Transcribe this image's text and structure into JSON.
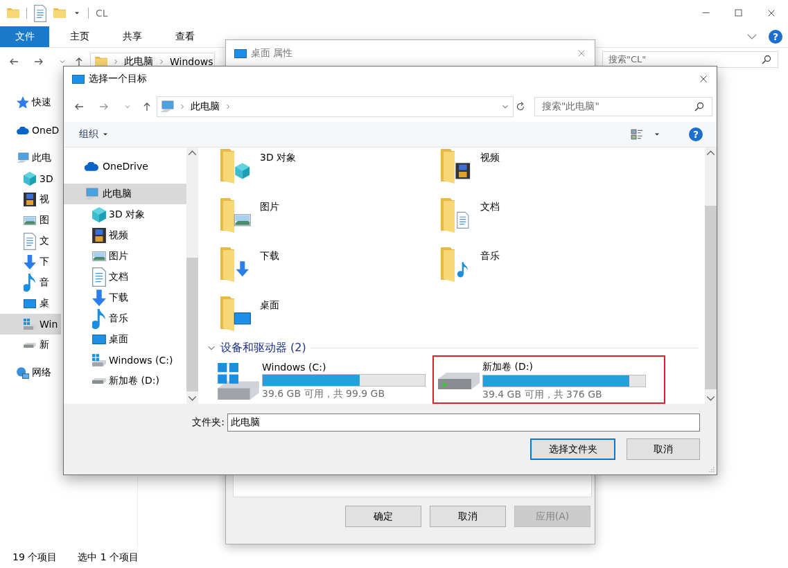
{
  "explorer": {
    "title": "CL",
    "ribbon_tabs": [
      {
        "label": "文件",
        "selected": true
      },
      {
        "label": "主页",
        "selected": false
      },
      {
        "label": "共享",
        "selected": false
      },
      {
        "label": "查看",
        "selected": false
      }
    ],
    "help": "?",
    "address": [
      "此电脑",
      "Windows"
    ],
    "search": {
      "placeholder": "搜索\"CL\""
    },
    "nav": [
      {
        "label": "快速",
        "kind": "star",
        "selected": false
      },
      {
        "label": "OneD",
        "kind": "cloud",
        "selected": false
      },
      {
        "label": "此电",
        "kind": "pc",
        "selected": false,
        "children": [
          {
            "label": "3D",
            "kind": "cube",
            "selected": false
          },
          {
            "label": "视",
            "kind": "video",
            "selected": false
          },
          {
            "label": "图",
            "kind": "pictures",
            "selected": false
          },
          {
            "label": "文",
            "kind": "docs",
            "selected": false
          },
          {
            "label": "下",
            "kind": "downloads",
            "selected": false
          },
          {
            "label": "音",
            "kind": "music",
            "selected": false
          },
          {
            "label": "桌",
            "kind": "desktop",
            "selected": false
          },
          {
            "label": "Win",
            "kind": "windrive",
            "selected": true
          },
          {
            "label": "新",
            "kind": "drive",
            "selected": false
          }
        ]
      },
      {
        "label": "网络",
        "kind": "network",
        "selected": false
      }
    ],
    "status_bar": {
      "count": "19 个项目",
      "selection": "选中 1 个项目"
    }
  },
  "properties_dialog": {
    "title": "桌面 属性",
    "buttons": [
      {
        "label": "确定",
        "disabled": false
      },
      {
        "label": "取消",
        "disabled": false
      },
      {
        "label": "应用(A)",
        "disabled": true
      }
    ]
  },
  "picker": {
    "title": "选择一个目标",
    "breadcrumb": [
      "此电脑"
    ],
    "search": {
      "placeholder": "搜索\"此电脑\""
    },
    "organize": "组织",
    "help": "?",
    "tree": [
      {
        "label": "OneDrive",
        "kind": "cloud",
        "selected": false
      },
      {
        "label": "此电脑",
        "kind": "pc",
        "selected": true,
        "children": [
          {
            "label": "3D 对象",
            "kind": "cube",
            "selected": false
          },
          {
            "label": "视频",
            "kind": "video",
            "selected": false
          },
          {
            "label": "图片",
            "kind": "pictures",
            "selected": false
          },
          {
            "label": "文档",
            "kind": "docs",
            "selected": false
          },
          {
            "label": "下载",
            "kind": "downloads",
            "selected": false
          },
          {
            "label": "音乐",
            "kind": "music",
            "selected": false
          },
          {
            "label": "桌面",
            "kind": "desktop",
            "selected": false
          },
          {
            "label": "Windows (C:)",
            "kind": "windrive",
            "selected": false
          },
          {
            "label": "新加卷 (D:)",
            "kind": "drive",
            "selected": false
          }
        ]
      }
    ],
    "folders": [
      {
        "label": "3D 对象",
        "kind": "cube"
      },
      {
        "label": "视频",
        "kind": "video"
      },
      {
        "label": "图片",
        "kind": "pictures"
      },
      {
        "label": "文档",
        "kind": "docs"
      },
      {
        "label": "下载",
        "kind": "downloads"
      },
      {
        "label": "音乐",
        "kind": "music"
      },
      {
        "label": "桌面",
        "kind": "desktop"
      }
    ],
    "devices_group": {
      "label": "设备和驱动器 (2)",
      "expanded": true
    },
    "drives": [
      {
        "name": "Windows (C:)",
        "kind": "windrive",
        "level": 0.6,
        "free": "39.6 GB 可用，共 99.9 GB",
        "highlighted": false
      },
      {
        "name": "新加卷 (D:)",
        "kind": "drive",
        "level": 0.9,
        "free": "39.4 GB 可用，共 376 GB",
        "highlighted": true
      }
    ],
    "folder_field": {
      "label": "文件夹:",
      "value": "此电脑"
    },
    "buttons": [
      {
        "label": "选择文件夹",
        "default": true
      },
      {
        "label": "取消",
        "default": false
      }
    ]
  }
}
